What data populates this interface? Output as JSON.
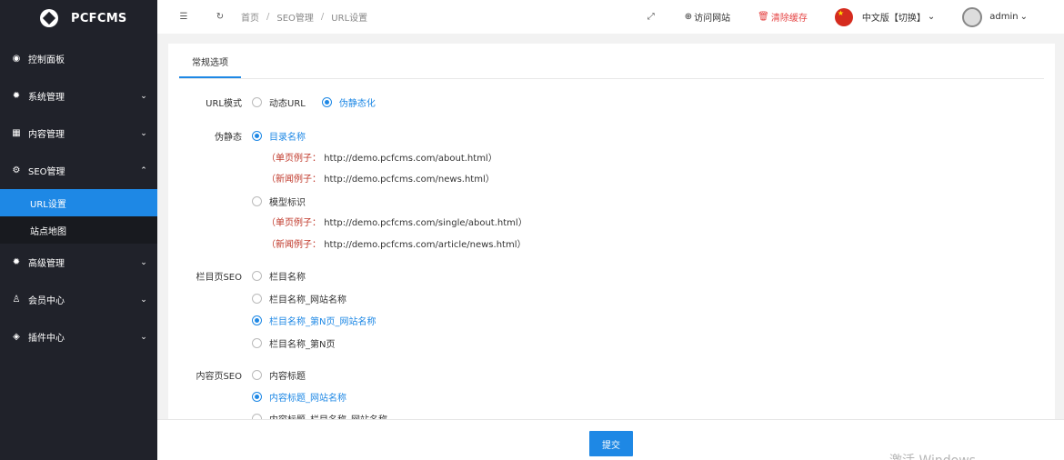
{
  "app": {
    "name": "PCFCMS"
  },
  "sidebar": {
    "items": [
      {
        "label": "控制面板",
        "icon": "dashboard-icon"
      },
      {
        "label": "系统管理",
        "icon": "gear-icon"
      },
      {
        "label": "内容管理",
        "icon": "grid-icon"
      },
      {
        "label": "SEO管理",
        "icon": "cog-icon",
        "expanded": true
      },
      {
        "label": "高级管理",
        "icon": "gear-icon"
      },
      {
        "label": "会员中心",
        "icon": "user-icon"
      },
      {
        "label": "插件中心",
        "icon": "layers-icon"
      }
    ],
    "seo_sub": [
      {
        "label": "URL设置",
        "active": true
      },
      {
        "label": "站点地图"
      }
    ]
  },
  "topbar": {
    "breadcrumb": [
      "首页",
      "SEO管理",
      "URL设置"
    ],
    "visit_site": "访问网站",
    "clear_cache": "清除缓存",
    "language": "中文版【切换】",
    "user": "admin"
  },
  "tabs": [
    {
      "label": "常规选项",
      "active": true
    }
  ],
  "form": {
    "url_mode": {
      "label": "URL模式",
      "options": [
        "动态URL",
        "伪静态化"
      ],
      "selected": 1
    },
    "pseudo_static": {
      "label": "伪静态",
      "opt1": "目录名称",
      "opt1_examples": [
        {
          "tag": "（单页例子：",
          "url": "http://demo.pcfcms.com/about.html）"
        },
        {
          "tag": "（新闻例子：",
          "url": "http://demo.pcfcms.com/news.html）"
        }
      ],
      "opt2": "模型标识",
      "opt2_examples": [
        {
          "tag": "（单页例子：",
          "url": "http://demo.pcfcms.com/single/about.html）"
        },
        {
          "tag": "（新闻例子：",
          "url": "http://demo.pcfcms.com/article/news.html）"
        }
      ],
      "selected": 0
    },
    "column_seo": {
      "label": "栏目页SEO",
      "options": [
        "栏目名称",
        "栏目名称_网站名称",
        "栏目名称_第N页_网站名称",
        "栏目名称_第N页"
      ],
      "selected": 2
    },
    "content_seo": {
      "label": "内容页SEO",
      "options": [
        "内容标题",
        "内容标题_网站名称",
        "内容标题_栏目名称_网站名称"
      ],
      "selected": 1
    }
  },
  "footer": {
    "submit": "提交",
    "watermark": "激活 Windows"
  },
  "colors": {
    "accent": "#1e88e5",
    "sidebar_bg": "#20222a",
    "danger": "#e54545"
  }
}
